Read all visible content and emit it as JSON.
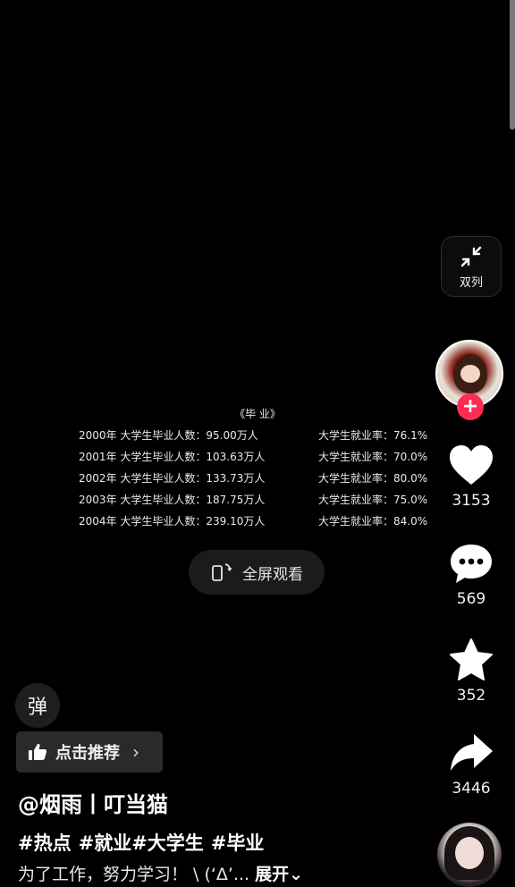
{
  "video": {
    "title": "《毕 业》",
    "rows": [
      {
        "left": "2000年 大学生毕业人数：95.00万人",
        "right": "大学生就业率：76.1%"
      },
      {
        "left": "2001年 大学生毕业人数：103.63万人",
        "right": "大学生就业率：70.0%"
      },
      {
        "left": "2002年 大学生毕业人数：133.73万人",
        "right": "大学生就业率：80.0%"
      },
      {
        "left": "2003年 大学生毕业人数：187.75万人",
        "right": "大学生就业率：75.0%"
      },
      {
        "left": "2004年 大学生毕业人数：239.10万人",
        "right": "大学生就业率：84.0%"
      }
    ],
    "fullscreen_label": "全屏观看"
  },
  "sidebar": {
    "dual_column_label": "双列",
    "follow_symbol": "+",
    "like_count": "3153",
    "comment_count": "569",
    "favorite_count": "352",
    "share_count": "3446"
  },
  "overlay": {
    "danmu_label": "弹",
    "recommend_label": "点击推荐",
    "recommend_chevron": "›",
    "author": "@烟雨丨叮当猫",
    "tags": [
      "#热点",
      "#就业#大学生",
      "#毕业"
    ],
    "description": "为了工作，努力学习！ \\ (‘Δ’...",
    "expand_label": "展开⌄"
  },
  "colors": {
    "background": "#000000",
    "accent": "#fe2c55",
    "icon": "#ffffff"
  }
}
